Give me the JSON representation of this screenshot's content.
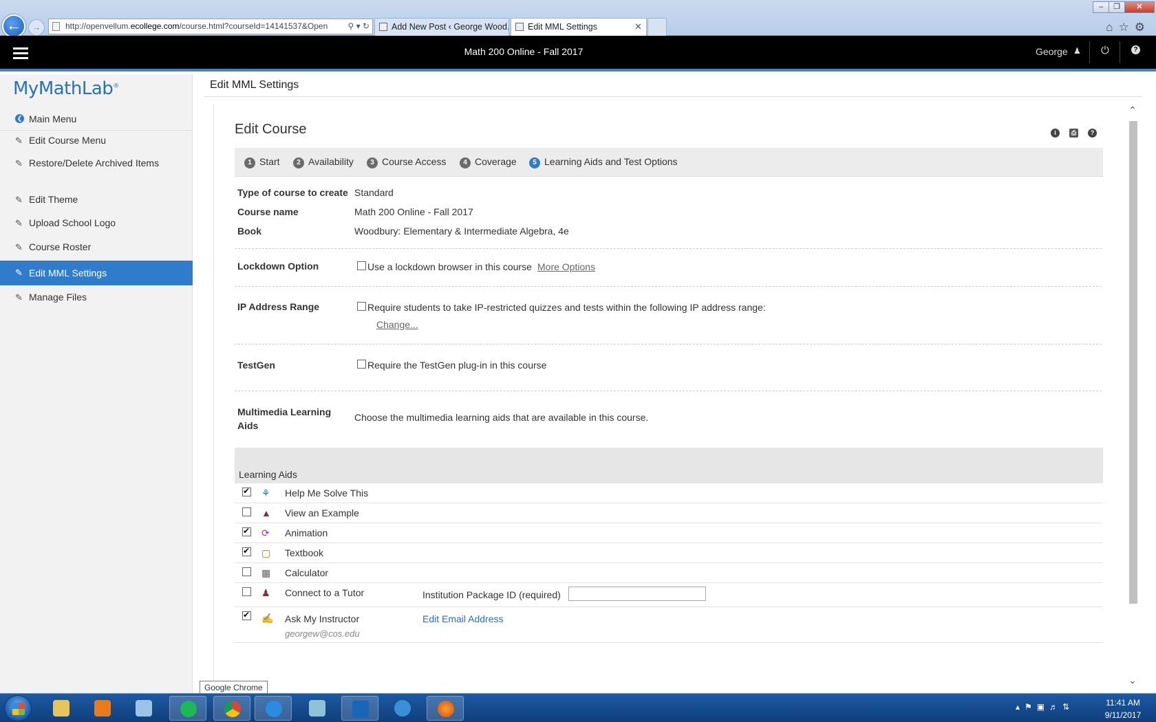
{
  "browser": {
    "url_prefix": "http://openvellum.",
    "url_domain": "ecollege.com",
    "url_suffix": "/course.html?courseId=14141537&Open",
    "tabs": [
      {
        "label": "Add New Post ‹ George Wood..."
      },
      {
        "label": "Edit MML Settings"
      }
    ],
    "tooltip": "Google Chrome"
  },
  "header": {
    "course_title": "Math 200 Online - Fall 2017",
    "user_name": "George"
  },
  "sidebar": {
    "logo": "MyMathLab",
    "items": [
      {
        "label": "Main Menu"
      },
      {
        "label": "Edit Course Menu"
      },
      {
        "label": "Restore/Delete Archived Items"
      },
      {
        "label": "Edit Theme"
      },
      {
        "label": "Upload School Logo"
      },
      {
        "label": "Course Roster"
      },
      {
        "label": "Edit MML Settings"
      },
      {
        "label": "Manage Files"
      }
    ]
  },
  "main": {
    "page_title": "Edit MML Settings",
    "section_title": "Edit Course",
    "steps": [
      {
        "num": "1",
        "label": "Start"
      },
      {
        "num": "2",
        "label": "Availability"
      },
      {
        "num": "3",
        "label": "Course Access"
      },
      {
        "num": "4",
        "label": "Coverage"
      },
      {
        "num": "5",
        "label": "Learning Aids and Test Options"
      }
    ],
    "course_type_label": "Type of course to create",
    "course_type_value": "Standard",
    "course_name_label": "Course name",
    "course_name_value": "Math 200 Online - Fall 2017",
    "book_label": "Book",
    "book_value": "Woodbury: Elementary & Intermediate Algebra, 4e",
    "lockdown": {
      "label": "Lockdown Option",
      "option_text": "Use a lockdown browser in this course",
      "checked": false,
      "more_link": "More Options"
    },
    "ip_range": {
      "label": "IP Address Range",
      "option_text": "Require students to take IP-restricted quizzes and tests within the following IP address range:",
      "checked": false,
      "change_link": "Change..."
    },
    "testgen": {
      "label": "TestGen",
      "option_text": "Require the TestGen plug-in in this course",
      "checked": false
    },
    "multimedia": {
      "label": "Multimedia Learning Aids",
      "description": "Choose the multimedia learning aids that are available in this course."
    },
    "learning_aids_header": "Learning Aids",
    "learning_aids": [
      {
        "label": "Help Me Solve This",
        "checked": true,
        "icon": "key-icon"
      },
      {
        "label": "View an Example",
        "checked": false,
        "icon": "binoculars-icon"
      },
      {
        "label": "Animation",
        "checked": true,
        "icon": "animation-icon"
      },
      {
        "label": "Textbook",
        "checked": true,
        "icon": "book-icon"
      },
      {
        "label": "Calculator",
        "checked": false,
        "icon": "calculator-icon"
      },
      {
        "label": "Connect to a Tutor",
        "checked": false,
        "icon": "tutor-icon"
      },
      {
        "label": "Ask My Instructor",
        "checked": true,
        "icon": "instructor-icon"
      }
    ],
    "tutor_package_label": "Institution Package ID (required)",
    "tutor_package_value": "",
    "edit_email_link": "Edit Email Address",
    "instructor_email": "georgew@cos.edu"
  },
  "taskbar": {
    "time": "11:41 AM",
    "date": "9/11/2017"
  }
}
